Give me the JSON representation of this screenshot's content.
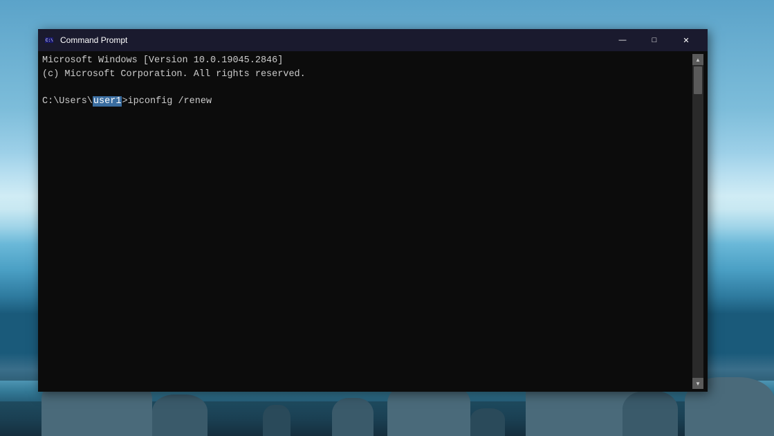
{
  "desktop": {
    "bg_description": "Windows 10 beach/ocean wallpaper"
  },
  "window": {
    "title": "Command Prompt",
    "icon": "cmd-icon",
    "minimize_label": "—",
    "maximize_label": "□",
    "close_label": "✕",
    "lines": [
      "Microsoft Windows [Version 10.0.19045.2846]",
      "(c) Microsoft Corporation. All rights reserved.",
      "",
      "C:\\Users\\user1>ipconfig /renew"
    ]
  }
}
